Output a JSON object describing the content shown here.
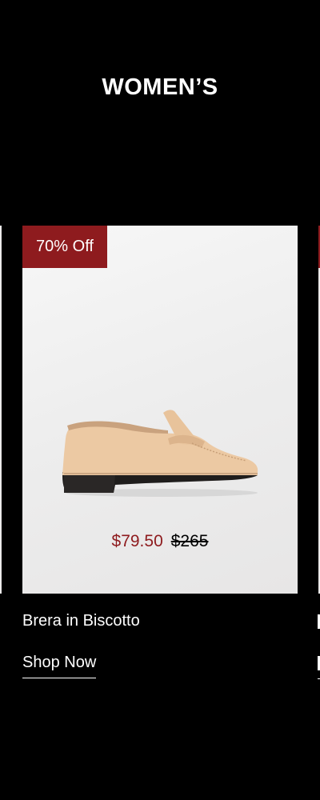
{
  "section": {
    "title": "WOMEN’S"
  },
  "product": {
    "badge": "70% Off",
    "name": "Brera in Biscotto",
    "sale_price": "$79.50",
    "original_price": "$265",
    "cta": "Shop Now",
    "image": "beige-penny-loafer"
  },
  "colors": {
    "background": "#000000",
    "accent": "#8e1b1e",
    "card_background": "#eeeeee",
    "text": "#ffffff"
  }
}
